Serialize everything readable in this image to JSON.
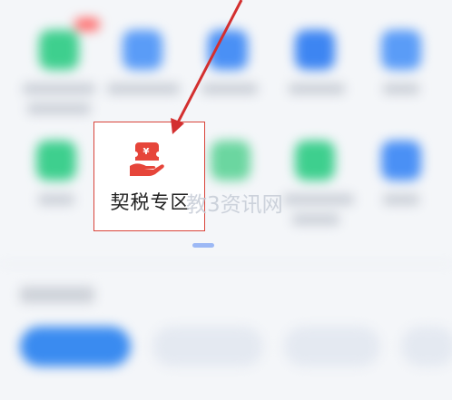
{
  "highlighted_item": {
    "label": "契税专区",
    "icon": "yuan-hand-icon",
    "icon_color": "#e6453a",
    "box_color": "#d9443a"
  },
  "watermark": {
    "text": "教3资讯网"
  },
  "arrow": {
    "color": "#d32f2f"
  },
  "colors": {
    "background": "#f4f6f9",
    "blue_tile": "#4a90f5",
    "green_tile": "#3ecf8e",
    "pill_primary": "#3a8bf0"
  }
}
